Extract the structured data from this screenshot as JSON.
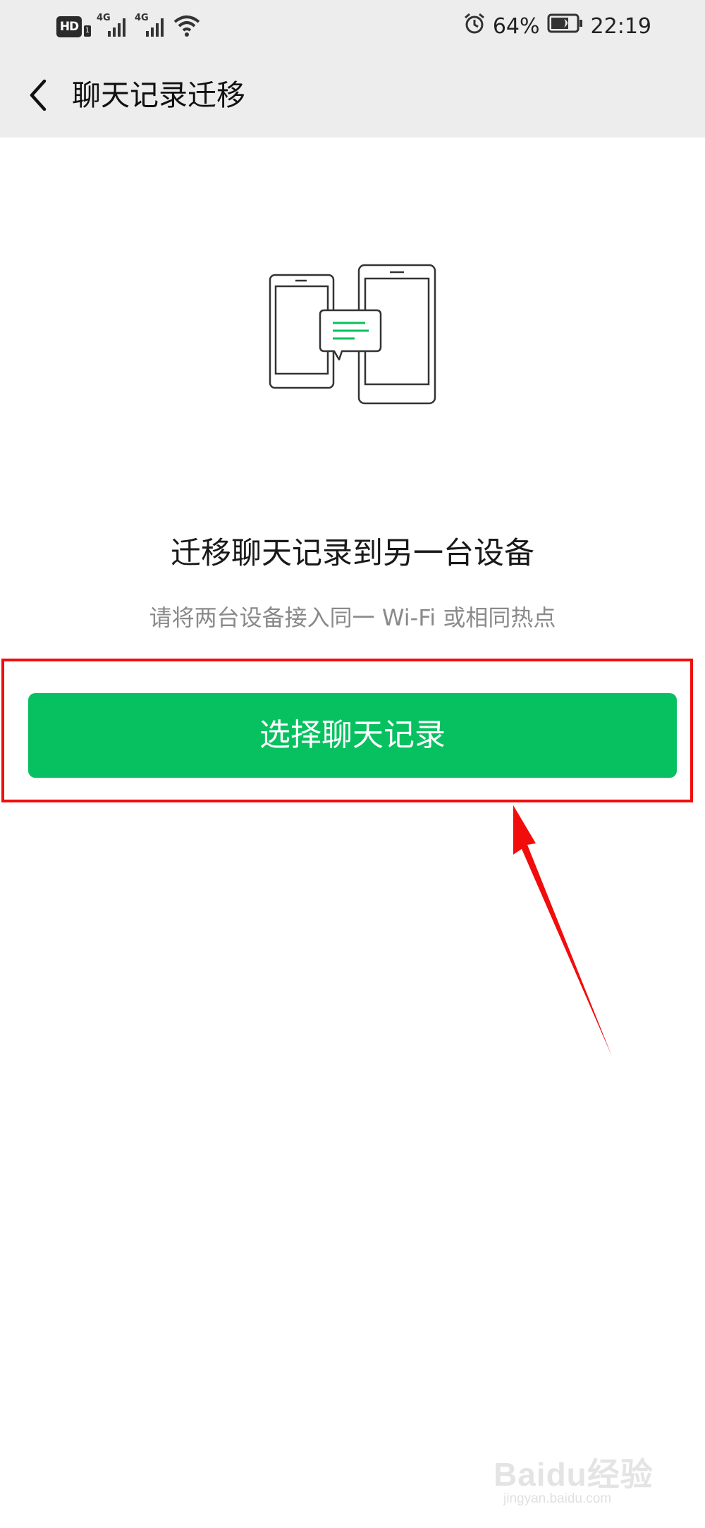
{
  "status_bar": {
    "hd_label": "HD",
    "network_1": "4G",
    "network_2": "4G",
    "battery_percent": "64%",
    "time": "22:19",
    "icons": [
      "hd-icon",
      "signal-icon",
      "signal-icon",
      "wifi-icon",
      "alarm-icon",
      "battery-icon"
    ]
  },
  "nav": {
    "back_icon": "chevron-left-icon",
    "title": "聊天记录迁移"
  },
  "illustration": {
    "icon": "two-phones-chat-icon",
    "accent_color": "#07c160"
  },
  "main": {
    "headline": "迁移聊天记录到另一台设备",
    "subtext": "请将两台设备接入同一 Wi-Fi 或相同热点",
    "primary_button": "选择聊天记录",
    "primary_color": "#07c160"
  },
  "annotation": {
    "highlight_color": "#f20c0c"
  },
  "watermark": {
    "brand": "Baidu经验",
    "site": "jingyan.baidu.com"
  }
}
